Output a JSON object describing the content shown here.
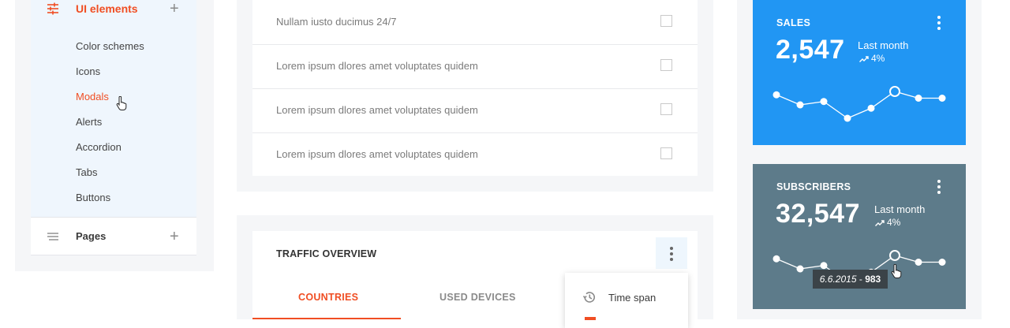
{
  "sidebar": {
    "section_label": "UI elements",
    "section_icon": "sliders-icon",
    "items": [
      {
        "label": "Color schemes",
        "active": false
      },
      {
        "label": "Icons",
        "active": false
      },
      {
        "label": "Modals",
        "active": true
      },
      {
        "label": "Alerts",
        "active": false
      },
      {
        "label": "Accordion",
        "active": false
      },
      {
        "label": "Tabs",
        "active": false
      },
      {
        "label": "Buttons",
        "active": false
      }
    ],
    "pages_label": "Pages",
    "pages_icon": "lines-icon",
    "expand_symbol": "+"
  },
  "tasks": {
    "rows": [
      {
        "text": "Nullam iusto ducimus 24/7",
        "checked": false
      },
      {
        "text": "Lorem ipsum dlores amet voluptates quidem",
        "checked": false
      },
      {
        "text": "Lorem ipsum dlores amet voluptates quidem",
        "checked": false
      },
      {
        "text": "Lorem ipsum dlores amet voluptates quidem",
        "checked": false
      }
    ]
  },
  "traffic": {
    "title": "TRAFFIC OVERVIEW",
    "tabs": [
      {
        "label": "COUNTRIES",
        "active": true
      },
      {
        "label": "USED DEVICES",
        "active": false
      }
    ],
    "dropdown": {
      "items": [
        {
          "label": "Time span",
          "icon": "history-icon"
        }
      ]
    }
  },
  "stats": {
    "sales": {
      "title": "SALES",
      "value": "2,547",
      "period": "Last month",
      "trend": "4%",
      "color": "#2196f3",
      "chart_data": {
        "type": "line",
        "values": [
          8,
          5,
          6,
          1,
          4,
          9,
          7,
          7
        ],
        "highlight_index": 5
      }
    },
    "subscribers": {
      "title": "SUBSCRIBERS",
      "value": "32,547",
      "period": "Last month",
      "trend": "4%",
      "color": "#5d7b8a",
      "chart_data": {
        "type": "line",
        "values": [
          8,
          5,
          6,
          1,
          4,
          9,
          7,
          7
        ],
        "highlight_index": 5
      },
      "tooltip": {
        "date": "6.6.2015",
        "separator": "-",
        "value": "983"
      }
    }
  },
  "accent_color": "#f04e23"
}
